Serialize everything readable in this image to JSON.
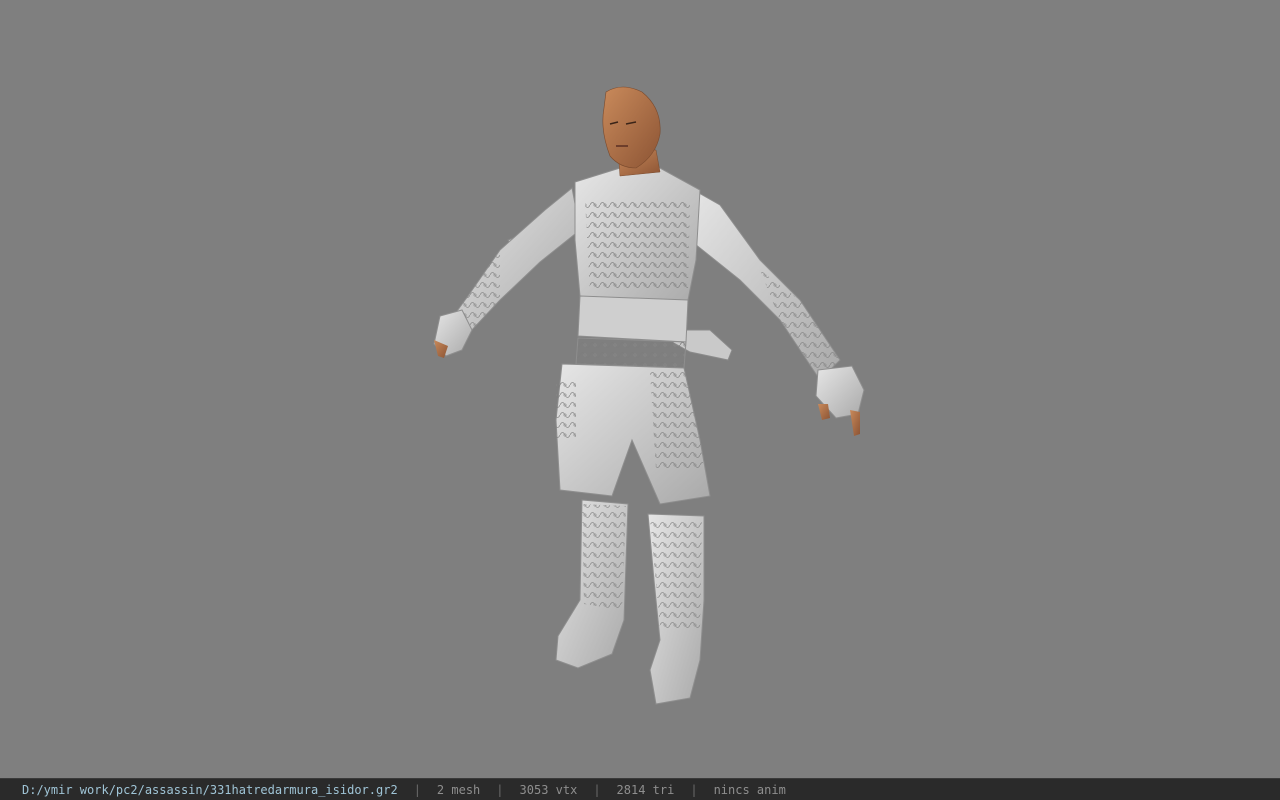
{
  "viewport": {
    "background": "#7f7f7f",
    "subject": "character-model"
  },
  "status": {
    "path": "D:/ymir work/pc2/assassin/331hatredarmura_isidor.gr2",
    "separator": "|",
    "mesh": "2 mesh",
    "vtx": "3053 vtx",
    "tri": "2814 tri",
    "anim": "nincs anim"
  }
}
